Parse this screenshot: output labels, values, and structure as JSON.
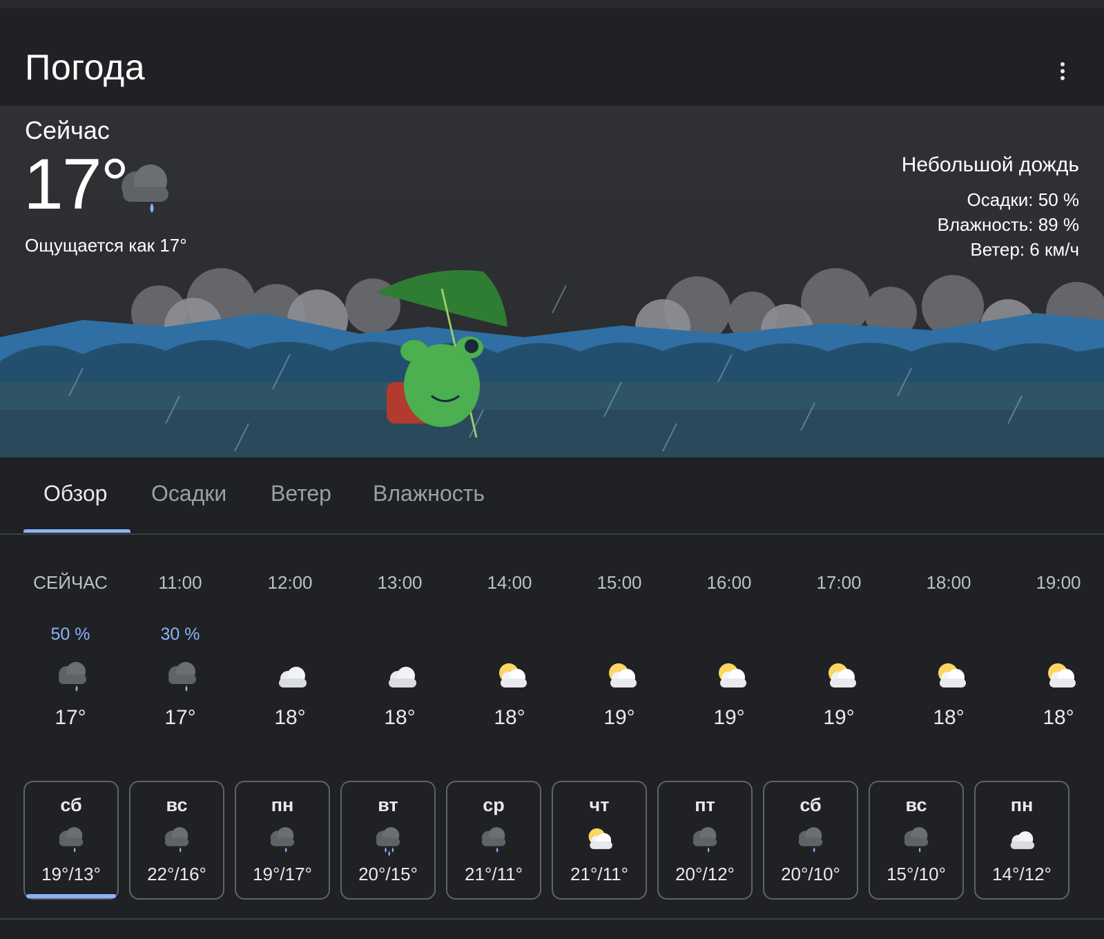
{
  "app": {
    "title": "Погода"
  },
  "current": {
    "label": "Сейчас",
    "temp": "17°",
    "icon": "rain-cloud-icon",
    "feels_like": "Ощущается как 17°",
    "condition": "Небольшой дождь",
    "stats": [
      "Осадки: 50 %",
      "Влажность: 89 %",
      "Ветер: 6 км/ч"
    ]
  },
  "tabs": [
    {
      "label": "Обзор",
      "active": true
    },
    {
      "label": "Осадки",
      "active": false
    },
    {
      "label": "Ветер",
      "active": false
    },
    {
      "label": "Влажность",
      "active": false
    }
  ],
  "hourly": [
    {
      "time": "СЕЙЧАС",
      "pop": "50 %",
      "icon": "rain",
      "temp": "17°"
    },
    {
      "time": "11:00",
      "pop": "30 %",
      "icon": "rain",
      "temp": "17°"
    },
    {
      "time": "12:00",
      "pop": "",
      "icon": "cloud",
      "temp": "18°"
    },
    {
      "time": "13:00",
      "pop": "",
      "icon": "cloud",
      "temp": "18°"
    },
    {
      "time": "14:00",
      "pop": "",
      "icon": "partly",
      "temp": "18°"
    },
    {
      "time": "15:00",
      "pop": "",
      "icon": "partly",
      "temp": "19°"
    },
    {
      "time": "16:00",
      "pop": "",
      "icon": "partly",
      "temp": "19°"
    },
    {
      "time": "17:00",
      "pop": "",
      "icon": "partly",
      "temp": "19°"
    },
    {
      "time": "18:00",
      "pop": "",
      "icon": "partly",
      "temp": "18°"
    },
    {
      "time": "19:00",
      "pop": "",
      "icon": "partly",
      "temp": "18°"
    }
  ],
  "daily": [
    {
      "day": "сб",
      "icon": "rain",
      "range": "19°/13°",
      "active": true
    },
    {
      "day": "вс",
      "icon": "rain",
      "range": "22°/16°",
      "active": false
    },
    {
      "day": "пн",
      "icon": "rain",
      "range": "19°/17°",
      "active": false
    },
    {
      "day": "вт",
      "icon": "heavy-rain",
      "range": "20°/15°",
      "active": false
    },
    {
      "day": "ср",
      "icon": "rain",
      "range": "21°/11°",
      "active": false
    },
    {
      "day": "чт",
      "icon": "partly",
      "range": "21°/11°",
      "active": false
    },
    {
      "day": "пт",
      "icon": "rain",
      "range": "20°/12°",
      "active": false
    },
    {
      "day": "сб",
      "icon": "rain",
      "range": "20°/10°",
      "active": false
    },
    {
      "day": "вс",
      "icon": "rain",
      "range": "15°/10°",
      "active": false
    },
    {
      "day": "пн",
      "icon": "cloud",
      "range": "14°/12°",
      "active": false
    }
  ],
  "colors": {
    "accent": "#8ab4f8",
    "background": "#202124",
    "sun": "#fdd663"
  }
}
